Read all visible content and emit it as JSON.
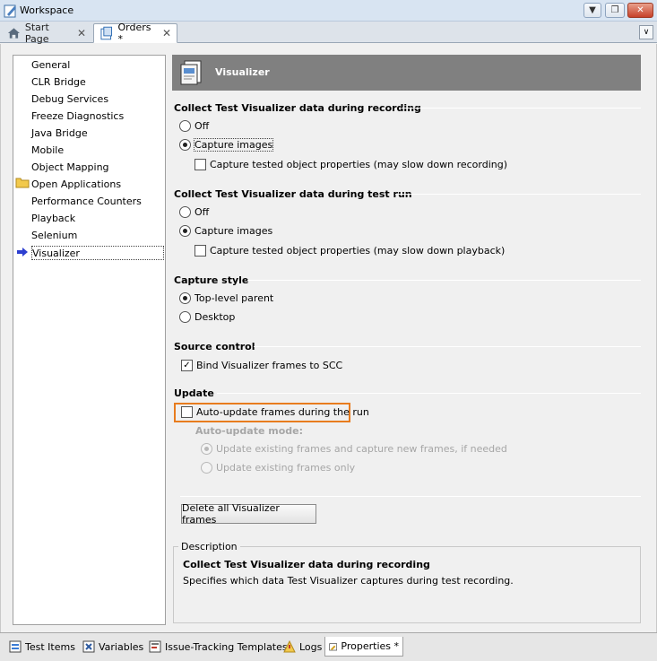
{
  "window": {
    "title": "Workspace",
    "dropdown_glyph": "▼",
    "restore_glyph": "❐",
    "close_glyph": "✕"
  },
  "tabs": [
    {
      "label": "Start Page",
      "close": "✕"
    },
    {
      "label": "Orders *",
      "close": "✕"
    }
  ],
  "tab_overflow_glyph": "∨",
  "nav": {
    "items": [
      "General",
      "CLR Bridge",
      "Debug Services",
      "Freeze Diagnostics",
      "Java Bridge",
      "Mobile",
      "Object Mapping",
      "Open Applications",
      "Performance Counters",
      "Playback",
      "Selenium",
      "Visualizer"
    ],
    "selected": "Visualizer"
  },
  "header": {
    "title": "Visualizer"
  },
  "sections": {
    "recording": {
      "title": "Collect Test Visualizer data during recording",
      "off": "Off",
      "capture_images": "Capture images",
      "capture_props": "Capture tested object properties (may slow down recording)"
    },
    "testrun": {
      "title": "Collect Test Visualizer data during test run",
      "off": "Off",
      "capture_images": "Capture images",
      "capture_props": "Capture tested object properties (may slow down playback)"
    },
    "style": {
      "title": "Capture style",
      "top_level": "Top-level parent",
      "desktop": "Desktop"
    },
    "scc": {
      "title": "Source control",
      "bind": "Bind Visualizer frames to SCC",
      "check_glyph": "✓"
    },
    "update": {
      "title": "Update",
      "auto_update": "Auto-update frames during the run",
      "mode_label": "Auto-update mode:",
      "mode_existing_new": "Update existing frames and capture new frames, if needed",
      "mode_existing_only": "Update existing frames only"
    }
  },
  "delete_button": "Delete all Visualizer frames",
  "description": {
    "label": "Description",
    "title": "Collect Test Visualizer data during recording",
    "text": "Specifies which data Test Visualizer captures during test recording."
  },
  "bottom_tabs": [
    "Test Items",
    "Variables",
    "Issue-Tracking Templates",
    "Logs",
    "Properties *"
  ],
  "colors": {
    "highlight": "#e87c1e",
    "header_bg": "#808080"
  }
}
